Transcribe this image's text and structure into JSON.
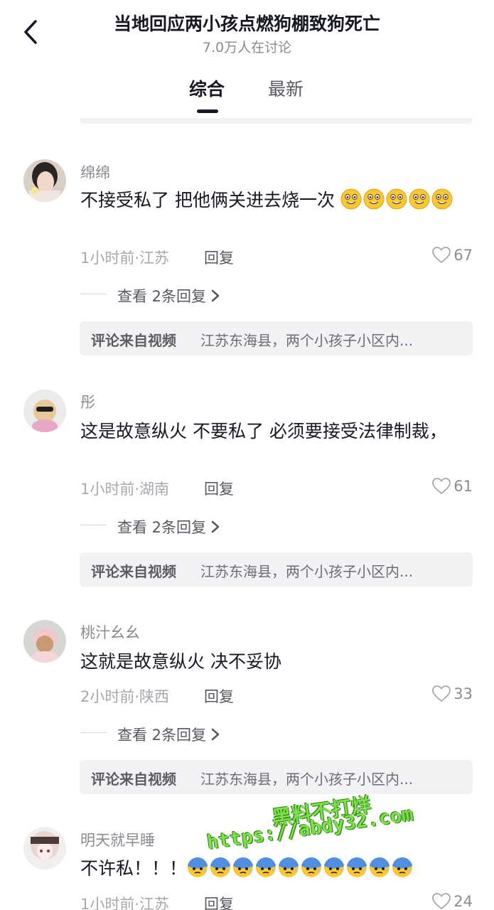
{
  "header": {
    "title": "当地回应两小孩点燃狗棚致狗死亡",
    "subtitle": "7.0万人在讨论",
    "tabs": [
      {
        "label": "综合",
        "active": true
      },
      {
        "label": "最新",
        "active": false
      }
    ]
  },
  "comments": [
    {
      "username": "绵绵",
      "text": "不接受私了 把他俩关进去烧一次",
      "emoji": "smile-emoji",
      "emoji_count": 5,
      "time_location": "1小时前·江苏",
      "reply_label": "回复",
      "likes": "67",
      "view_replies": "查看 2条回复",
      "source_label": "评论来自视频",
      "source_text": "江苏东海县，两个小孩子小区内..."
    },
    {
      "username": "彤",
      "text": "这是故意纵火 不要私了 必须要接受法律制裁，",
      "time_location": "1小时前·湖南",
      "reply_label": "回复",
      "likes": "61",
      "view_replies": "查看 2条回复",
      "source_label": "评论来自视频",
      "source_text": "江苏东海县，两个小孩子小区内..."
    },
    {
      "username": "桃汁幺幺",
      "text": "这就是故意纵火 决不妥协",
      "time_location": "2小时前·陕西",
      "reply_label": "回复",
      "likes": "33",
      "view_replies": "查看 2条回复",
      "source_label": "评论来自视频",
      "source_text": "江苏东海县，两个小孩子小区内..."
    },
    {
      "username": "明天就早睡",
      "text": "不许私！！！",
      "emoji": "cold-sweat-emoji",
      "emoji_count": 10,
      "time_location": "1小时前·江苏",
      "reply_label": "回复",
      "likes": "24"
    }
  ],
  "watermark": {
    "line1": "黑料不打烊",
    "line2": "https://abdy32.com"
  },
  "colors": {
    "primary_text": "#161823",
    "secondary_text": "#8a8b91",
    "source_bg": "#f2f2f4",
    "watermark_green": "#7de24a"
  }
}
